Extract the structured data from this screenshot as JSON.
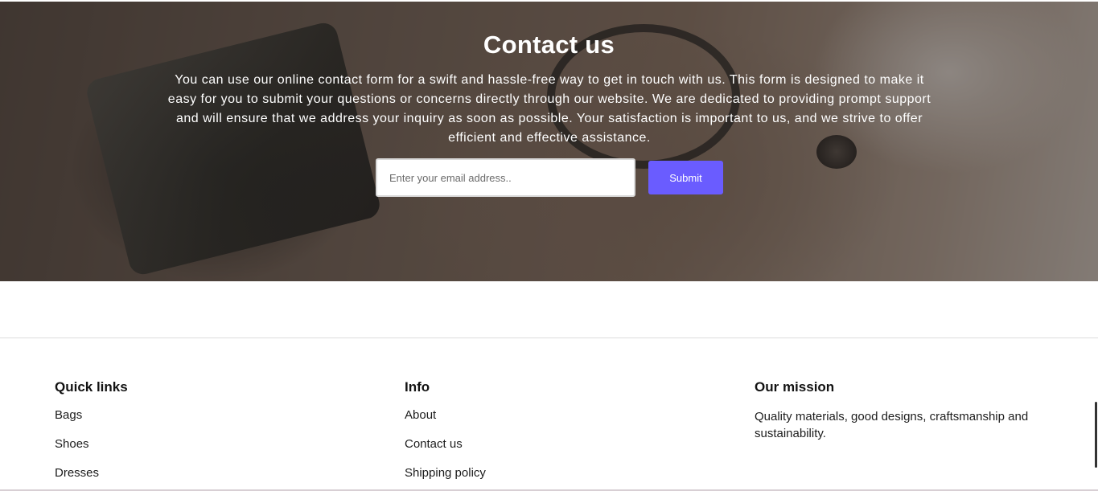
{
  "hero": {
    "title": "Contact us",
    "description": "You can use our online contact form for a swift and hassle-free way to get in touch with us. This form is designed to make it easy for you to submit your questions or concerns directly through our website. We are dedicated to providing prompt support and will ensure that we address your inquiry as soon as possible. Your satisfaction is important to us, and we strive to offer efficient and effective assistance.",
    "email_placeholder": "Enter your email address..",
    "email_value": "",
    "submit_label": "Submit"
  },
  "footer": {
    "quick_links": {
      "heading": "Quick links",
      "items": [
        "Bags",
        "Shoes",
        "Dresses"
      ]
    },
    "info": {
      "heading": "Info",
      "items": [
        "About",
        "Contact us",
        "Shipping policy"
      ]
    },
    "mission": {
      "heading": "Our mission",
      "text": "Quality materials, good designs, craftsmanship and sustainability."
    }
  },
  "colors": {
    "accent": "#6a5cff",
    "text": "#121212",
    "divider": "#dcdcdc"
  }
}
